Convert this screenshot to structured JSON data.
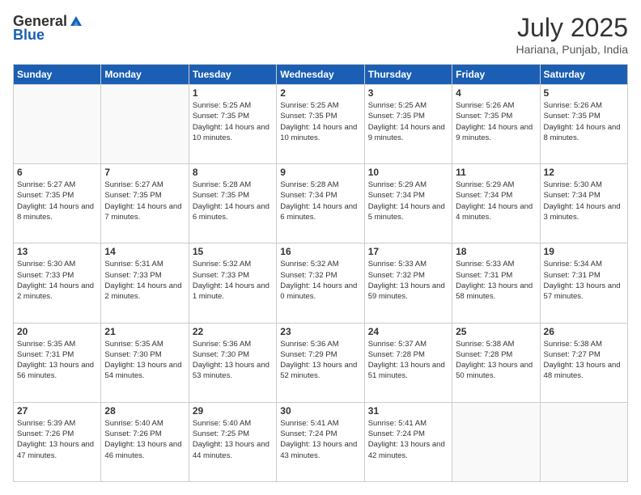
{
  "header": {
    "logo_general": "General",
    "logo_blue": "Blue",
    "month_title": "July 2025",
    "location": "Hariana, Punjab, India"
  },
  "days_of_week": [
    "Sunday",
    "Monday",
    "Tuesday",
    "Wednesday",
    "Thursday",
    "Friday",
    "Saturday"
  ],
  "weeks": [
    [
      {
        "day": "",
        "info": ""
      },
      {
        "day": "",
        "info": ""
      },
      {
        "day": "1",
        "info": "Sunrise: 5:25 AM\nSunset: 7:35 PM\nDaylight: 14 hours and 10 minutes."
      },
      {
        "day": "2",
        "info": "Sunrise: 5:25 AM\nSunset: 7:35 PM\nDaylight: 14 hours and 10 minutes."
      },
      {
        "day": "3",
        "info": "Sunrise: 5:25 AM\nSunset: 7:35 PM\nDaylight: 14 hours and 9 minutes."
      },
      {
        "day": "4",
        "info": "Sunrise: 5:26 AM\nSunset: 7:35 PM\nDaylight: 14 hours and 9 minutes."
      },
      {
        "day": "5",
        "info": "Sunrise: 5:26 AM\nSunset: 7:35 PM\nDaylight: 14 hours and 8 minutes."
      }
    ],
    [
      {
        "day": "6",
        "info": "Sunrise: 5:27 AM\nSunset: 7:35 PM\nDaylight: 14 hours and 8 minutes."
      },
      {
        "day": "7",
        "info": "Sunrise: 5:27 AM\nSunset: 7:35 PM\nDaylight: 14 hours and 7 minutes."
      },
      {
        "day": "8",
        "info": "Sunrise: 5:28 AM\nSunset: 7:35 PM\nDaylight: 14 hours and 6 minutes."
      },
      {
        "day": "9",
        "info": "Sunrise: 5:28 AM\nSunset: 7:34 PM\nDaylight: 14 hours and 6 minutes."
      },
      {
        "day": "10",
        "info": "Sunrise: 5:29 AM\nSunset: 7:34 PM\nDaylight: 14 hours and 5 minutes."
      },
      {
        "day": "11",
        "info": "Sunrise: 5:29 AM\nSunset: 7:34 PM\nDaylight: 14 hours and 4 minutes."
      },
      {
        "day": "12",
        "info": "Sunrise: 5:30 AM\nSunset: 7:34 PM\nDaylight: 14 hours and 3 minutes."
      }
    ],
    [
      {
        "day": "13",
        "info": "Sunrise: 5:30 AM\nSunset: 7:33 PM\nDaylight: 14 hours and 2 minutes."
      },
      {
        "day": "14",
        "info": "Sunrise: 5:31 AM\nSunset: 7:33 PM\nDaylight: 14 hours and 2 minutes."
      },
      {
        "day": "15",
        "info": "Sunrise: 5:32 AM\nSunset: 7:33 PM\nDaylight: 14 hours and 1 minute."
      },
      {
        "day": "16",
        "info": "Sunrise: 5:32 AM\nSunset: 7:32 PM\nDaylight: 14 hours and 0 minutes."
      },
      {
        "day": "17",
        "info": "Sunrise: 5:33 AM\nSunset: 7:32 PM\nDaylight: 13 hours and 59 minutes."
      },
      {
        "day": "18",
        "info": "Sunrise: 5:33 AM\nSunset: 7:31 PM\nDaylight: 13 hours and 58 minutes."
      },
      {
        "day": "19",
        "info": "Sunrise: 5:34 AM\nSunset: 7:31 PM\nDaylight: 13 hours and 57 minutes."
      }
    ],
    [
      {
        "day": "20",
        "info": "Sunrise: 5:35 AM\nSunset: 7:31 PM\nDaylight: 13 hours and 56 minutes."
      },
      {
        "day": "21",
        "info": "Sunrise: 5:35 AM\nSunset: 7:30 PM\nDaylight: 13 hours and 54 minutes."
      },
      {
        "day": "22",
        "info": "Sunrise: 5:36 AM\nSunset: 7:30 PM\nDaylight: 13 hours and 53 minutes."
      },
      {
        "day": "23",
        "info": "Sunrise: 5:36 AM\nSunset: 7:29 PM\nDaylight: 13 hours and 52 minutes."
      },
      {
        "day": "24",
        "info": "Sunrise: 5:37 AM\nSunset: 7:28 PM\nDaylight: 13 hours and 51 minutes."
      },
      {
        "day": "25",
        "info": "Sunrise: 5:38 AM\nSunset: 7:28 PM\nDaylight: 13 hours and 50 minutes."
      },
      {
        "day": "26",
        "info": "Sunrise: 5:38 AM\nSunset: 7:27 PM\nDaylight: 13 hours and 48 minutes."
      }
    ],
    [
      {
        "day": "27",
        "info": "Sunrise: 5:39 AM\nSunset: 7:26 PM\nDaylight: 13 hours and 47 minutes."
      },
      {
        "day": "28",
        "info": "Sunrise: 5:40 AM\nSunset: 7:26 PM\nDaylight: 13 hours and 46 minutes."
      },
      {
        "day": "29",
        "info": "Sunrise: 5:40 AM\nSunset: 7:25 PM\nDaylight: 13 hours and 44 minutes."
      },
      {
        "day": "30",
        "info": "Sunrise: 5:41 AM\nSunset: 7:24 PM\nDaylight: 13 hours and 43 minutes."
      },
      {
        "day": "31",
        "info": "Sunrise: 5:41 AM\nSunset: 7:24 PM\nDaylight: 13 hours and 42 minutes."
      },
      {
        "day": "",
        "info": ""
      },
      {
        "day": "",
        "info": ""
      }
    ]
  ]
}
